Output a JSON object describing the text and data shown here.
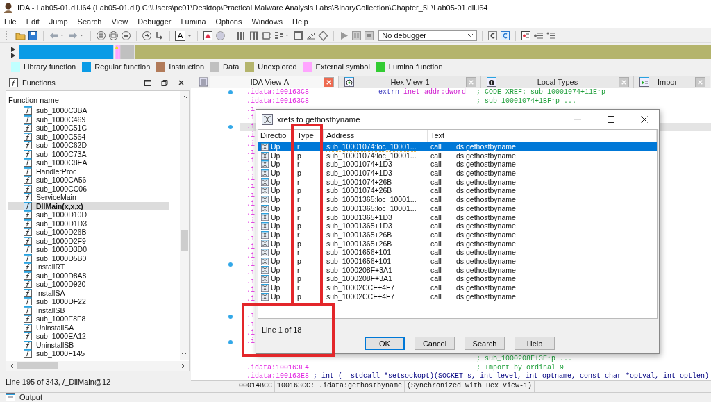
{
  "window": {
    "title": "IDA - Lab05-01.dll.i64 (Lab05-01.dll) C:\\Users\\pc01\\Desktop\\Practical Malware Analysis Labs\\BinaryCollection\\Chapter_5L\\Lab05-01.dll.i64"
  },
  "menu": [
    "File",
    "Edit",
    "Jump",
    "Search",
    "View",
    "Debugger",
    "Lumina",
    "Options",
    "Windows",
    "Help"
  ],
  "toolbar": {
    "text_button": "A",
    "debugger": "No debugger"
  },
  "legend": [
    {
      "label": "Library function",
      "color": "#c0ffff"
    },
    {
      "label": "Regular function",
      "color": "#0a9be6"
    },
    {
      "label": "Instruction",
      "color": "#b27b5a"
    },
    {
      "label": "Data",
      "color": "#c0c0c0"
    },
    {
      "label": "Unexplored",
      "color": "#b4b46c"
    },
    {
      "label": "External symbol",
      "color": "#ffa5ff"
    },
    {
      "label": "Lumina function",
      "color": "#33cc33"
    }
  ],
  "functions": {
    "title": "Functions",
    "column": "Function name",
    "items": [
      {
        "name": "sub_1000C3BA",
        "selected": false
      },
      {
        "name": "sub_1000C469",
        "selected": false
      },
      {
        "name": "sub_1000C51C",
        "selected": false
      },
      {
        "name": "sub_1000C564",
        "selected": false
      },
      {
        "name": "sub_1000C62D",
        "selected": false
      },
      {
        "name": "sub_1000C73A",
        "selected": false
      },
      {
        "name": "sub_1000C8EA",
        "selected": false
      },
      {
        "name": "HandlerProc",
        "selected": false
      },
      {
        "name": "sub_1000CA56",
        "selected": false
      },
      {
        "name": "sub_1000CC06",
        "selected": false
      },
      {
        "name": "ServiceMain",
        "selected": false
      },
      {
        "name": "DllMain(x,x,x)",
        "selected": true
      },
      {
        "name": "sub_1000D10D",
        "selected": false
      },
      {
        "name": "sub_1000D1D3",
        "selected": false
      },
      {
        "name": "sub_1000D26B",
        "selected": false
      },
      {
        "name": "sub_1000D2F9",
        "selected": false
      },
      {
        "name": "sub_1000D3D0",
        "selected": false
      },
      {
        "name": "sub_1000D5B0",
        "selected": false
      },
      {
        "name": "InstallRT",
        "selected": false
      },
      {
        "name": "sub_1000D8A8",
        "selected": false
      },
      {
        "name": "sub_1000D920",
        "selected": false
      },
      {
        "name": "InstallSA",
        "selected": false
      },
      {
        "name": "sub_1000DF22",
        "selected": false
      },
      {
        "name": "InstallSB",
        "selected": false
      },
      {
        "name": "sub_1000E8F8",
        "selected": false
      },
      {
        "name": "UninstallSA",
        "selected": false
      },
      {
        "name": "sub_1000EA12",
        "selected": false
      },
      {
        "name": "UninstallSB",
        "selected": false
      },
      {
        "name": "sub_1000F145",
        "selected": false
      }
    ],
    "status": "Line 195 of 343, /_DllMain@12"
  },
  "tabs": [
    {
      "label": "IDA View-A",
      "kind": "disassembly",
      "selected": true
    },
    {
      "label": "Hex View-1",
      "kind": "hex",
      "selected": false
    },
    {
      "label": "Local Types",
      "kind": "types",
      "selected": false
    },
    {
      "label": "Impor",
      "kind": "imports",
      "selected": false
    }
  ],
  "disassembly": {
    "lines": [
      {
        "address": ".idata:100163C8",
        "keyword": "extrn",
        "operand": "inet_addr:dword",
        "comment": "; CODE XREF: sub_10001074+11E↑p",
        "bullet": true,
        "current": false
      },
      {
        "address": ".idata:100163C8",
        "comment": "; sub_10001074+1BF↑p ...",
        "bullet": false,
        "current": false
      },
      {
        "address": ".i",
        "bullet": false,
        "current": false
      },
      {
        "address": ".i",
        "bullet": false,
        "current": false
      },
      {
        "address": ".i",
        "bullet": true,
        "current": true
      },
      {
        "address": ".i",
        "bullet": false,
        "current": false
      },
      {
        "address": ".i",
        "bullet": false,
        "current": false
      },
      {
        "address": ".i",
        "bullet": false,
        "current": false
      },
      {
        "address": ".i",
        "bullet": false,
        "current": false
      },
      {
        "address": ".i",
        "bullet": false,
        "current": false
      },
      {
        "address": ".i",
        "bullet": false,
        "current": false
      },
      {
        "address": ".i",
        "bullet": false,
        "current": false
      },
      {
        "address": ".i",
        "bullet": false,
        "current": false
      },
      {
        "address": ".i",
        "bullet": false,
        "current": false
      },
      {
        "address": ".i",
        "bullet": false,
        "current": false
      },
      {
        "address": ".i",
        "bullet": false,
        "current": false
      },
      {
        "address": ".i",
        "bullet": false,
        "current": false
      },
      {
        "address": ".i",
        "bullet": false,
        "current": false
      },
      {
        "address": ".i",
        "bullet": false,
        "current": false
      },
      {
        "address": ".i",
        "bullet": false,
        "current": false
      },
      {
        "address": ".i",
        "bullet": true,
        "current": false
      },
      {
        "address": ".i",
        "bullet": false,
        "current": false
      },
      {
        "address": ".i",
        "bullet": false,
        "current": false
      },
      {
        "address": ".i",
        "bullet": false,
        "current": false
      },
      {
        "address": ".i",
        "bullet": false,
        "current": false
      },
      {
        "bullet": false,
        "current": false
      },
      {
        "address": ".i",
        "bullet": true,
        "current": false
      },
      {
        "address": ".i",
        "bullet": false,
        "current": false
      },
      {
        "address": ".i",
        "bullet": false,
        "current": false
      },
      {
        "address": ".i",
        "bullet": true,
        "current": false
      },
      {
        "bullet": false,
        "current": false
      },
      {
        "comment": "; sub_1000208F+3E↑p ...",
        "bullet": false,
        "current": false
      },
      {
        "address": ".idata:100163E4",
        "comment": "; Import by ordinal 9",
        "bullet": false,
        "current": false
      },
      {
        "address": ".idata:100163E8",
        "declaration": "; int (__stdcall *setsockopt)(SOCKET s, int level, int optname, const char *optval, int optlen)",
        "bullet": false,
        "current": false
      }
    ],
    "status": [
      "00014BCC",
      "100163CC: .idata:gethostbyname",
      "(Synchronized with Hex View-1)"
    ]
  },
  "dialog": {
    "title": "xrefs to gethostbyname",
    "columns": [
      "Directio",
      "Type",
      "Address",
      "Text"
    ],
    "rows": [
      {
        "direction": "Up",
        "type": "r",
        "address": "sub_10001074:loc_10001...",
        "instruction": "call",
        "operand": "ds:gethostbyname",
        "selected": true
      },
      {
        "direction": "Up",
        "type": "p",
        "address": "sub_10001074:loc_10001...",
        "instruction": "call",
        "operand": "ds:gethostbyname",
        "selected": false
      },
      {
        "direction": "Up",
        "type": "r",
        "address": "sub_10001074+1D3",
        "instruction": "call",
        "operand": "ds:gethostbyname",
        "selected": false
      },
      {
        "direction": "Up",
        "type": "p",
        "address": "sub_10001074+1D3",
        "instruction": "call",
        "operand": "ds:gethostbyname",
        "selected": false
      },
      {
        "direction": "Up",
        "type": "r",
        "address": "sub_10001074+26B",
        "instruction": "call",
        "operand": "ds:gethostbyname",
        "selected": false
      },
      {
        "direction": "Up",
        "type": "p",
        "address": "sub_10001074+26B",
        "instruction": "call",
        "operand": "ds:gethostbyname",
        "selected": false
      },
      {
        "direction": "Up",
        "type": "r",
        "address": "sub_10001365:loc_10001...",
        "instruction": "call",
        "operand": "ds:gethostbyname",
        "selected": false
      },
      {
        "direction": "Up",
        "type": "p",
        "address": "sub_10001365:loc_10001...",
        "instruction": "call",
        "operand": "ds:gethostbyname",
        "selected": false
      },
      {
        "direction": "Up",
        "type": "r",
        "address": "sub_10001365+1D3",
        "instruction": "call",
        "operand": "ds:gethostbyname",
        "selected": false
      },
      {
        "direction": "Up",
        "type": "p",
        "address": "sub_10001365+1D3",
        "instruction": "call",
        "operand": "ds:gethostbyname",
        "selected": false
      },
      {
        "direction": "Up",
        "type": "r",
        "address": "sub_10001365+26B",
        "instruction": "call",
        "operand": "ds:gethostbyname",
        "selected": false
      },
      {
        "direction": "Up",
        "type": "p",
        "address": "sub_10001365+26B",
        "instruction": "call",
        "operand": "ds:gethostbyname",
        "selected": false
      },
      {
        "direction": "Up",
        "type": "r",
        "address": "sub_10001656+101",
        "instruction": "call",
        "operand": "ds:gethostbyname",
        "selected": false
      },
      {
        "direction": "Up",
        "type": "p",
        "address": "sub_10001656+101",
        "instruction": "call",
        "operand": "ds:gethostbyname",
        "selected": false
      },
      {
        "direction": "Up",
        "type": "r",
        "address": "sub_1000208F+3A1",
        "instruction": "call",
        "operand": "ds:gethostbyname",
        "selected": false
      },
      {
        "direction": "Up",
        "type": "p",
        "address": "sub_1000208F+3A1",
        "instruction": "call",
        "operand": "ds:gethostbyname",
        "selected": false
      },
      {
        "direction": "Up",
        "type": "r",
        "address": "sub_10002CCE+4F7",
        "instruction": "call",
        "operand": "ds:gethostbyname",
        "selected": false
      },
      {
        "direction": "Up",
        "type": "p",
        "address": "sub_10002CCE+4F7",
        "instruction": "call",
        "operand": "ds:gethostbyname",
        "selected": false
      }
    ],
    "status": "Line 1 of 18",
    "buttons": [
      {
        "label": "OK",
        "default": true
      },
      {
        "label": "Cancel",
        "default": false
      },
      {
        "label": "Search",
        "default": false
      },
      {
        "label": "Help",
        "default": false
      }
    ]
  },
  "output": {
    "title": "Output"
  }
}
